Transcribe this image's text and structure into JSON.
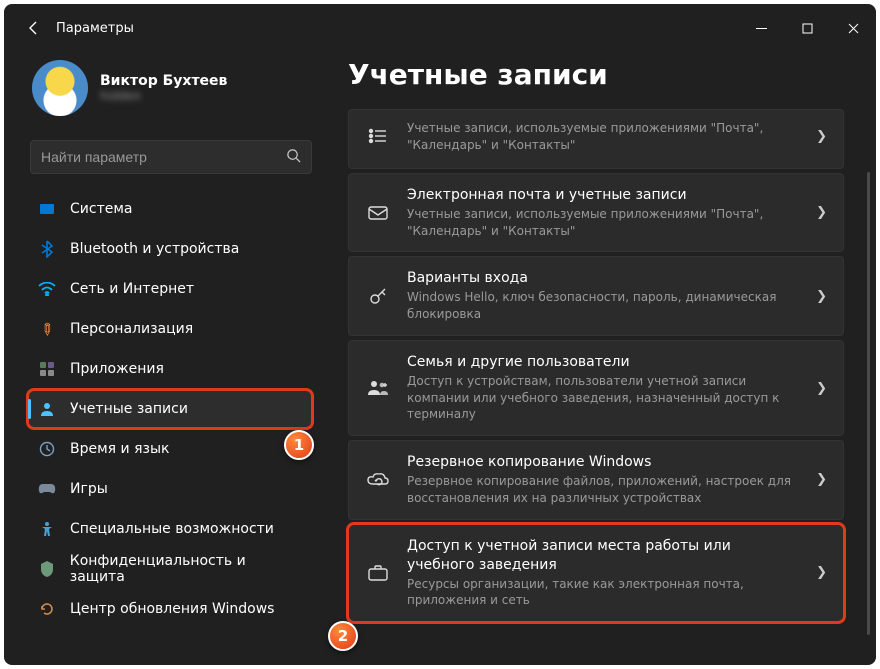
{
  "titlebar": {
    "title": "Параметры"
  },
  "profile": {
    "name": "Виктор Бухтеев",
    "email": "hidden"
  },
  "search": {
    "placeholder": "Найти параметр"
  },
  "nav": {
    "items": [
      {
        "label": "Система"
      },
      {
        "label": "Bluetooth и устройства"
      },
      {
        "label": "Сеть и Интернет"
      },
      {
        "label": "Персонализация"
      },
      {
        "label": "Приложения"
      },
      {
        "label": "Учетные записи"
      },
      {
        "label": "Время и язык"
      },
      {
        "label": "Игры"
      },
      {
        "label": "Специальные возможности"
      },
      {
        "label": "Конфиденциальность и защита"
      },
      {
        "label": "Центр обновления Windows"
      }
    ]
  },
  "page": {
    "title": "Учетные записи"
  },
  "cards": [
    {
      "title": "",
      "desc": "Учетные записи, используемые приложениями \"Почта\", \"Календарь\" и \"Контакты\""
    },
    {
      "title": "Электронная почта и учетные записи",
      "desc": "Учетные записи, используемые приложениями \"Почта\", \"Календарь\" и \"Контакты\""
    },
    {
      "title": "Варианты входа",
      "desc": "Windows Hello, ключ безопасности, пароль, динамическая блокировка"
    },
    {
      "title": "Семья и другие пользователи",
      "desc": "Доступ к устройствам, пользователи учетной записи компании или учебного заведения, назначенный доступ к терминалу"
    },
    {
      "title": "Резервное копирование Windows",
      "desc": "Резервное копирование файлов, приложений, настроек для восстановления их на различных устройствах"
    },
    {
      "title": "Доступ к учетной записи места работы или учебного заведения",
      "desc": "Ресурсы организации, такие как электронная почта, приложения и сеть"
    }
  ],
  "callouts": {
    "one": "1",
    "two": "2"
  }
}
